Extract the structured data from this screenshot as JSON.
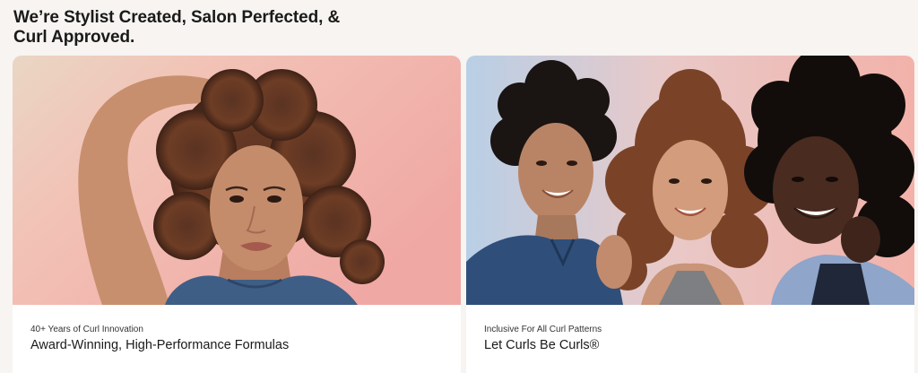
{
  "page": {
    "title": "We’re Stylist Created, Salon Perfected, & Curl Approved."
  },
  "cards": [
    {
      "eyebrow": "40+ Years of Curl Innovation",
      "heading": "Award-Winning, High-Performance Formulas",
      "image_subject": "woman with curly hair on pink background"
    },
    {
      "eyebrow": "Inclusive For All Curl Patterns",
      "heading": "Let Curls Be Curls®",
      "image_subject": "three smiling people with curly hair on pink-blue background"
    }
  ],
  "colors": {
    "page_background": "#f7f4f1",
    "card_background": "#ffffff",
    "text": "#1a1a1a",
    "photo_pink": "#f2b6ad",
    "photo_blue": "#b9cfe6"
  }
}
